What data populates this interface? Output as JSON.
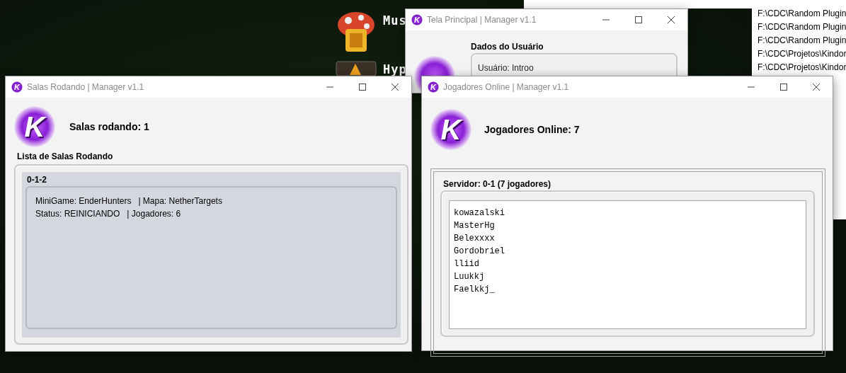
{
  "desktop": {
    "server_list": [
      {
        "name": "Mus",
        "kind": "mushroom"
      },
      {
        "name": "Hyp",
        "kind": "shield"
      }
    ],
    "explorer_paths": [
      "F:\\CDC\\Random Plugin",
      "F:\\CDC\\Random Plugin",
      "F:\\CDC\\Random Plugin",
      "F:\\CDC\\Projetos\\Kindor",
      "F:\\CDC\\Projetos\\Kindor"
    ]
  },
  "windows": [
    {
      "kind": "user",
      "title": "Tela Principal | Manager v1.1",
      "title_icon_text": "K",
      "section_title": "Dados do Usuário",
      "lines": [
        "Usuário: Introo"
      ]
    },
    {
      "kind": "rooms",
      "title": "Salas Rodando | Manager v1.1",
      "title_icon_text": "K",
      "logo_text": "K",
      "heading": "Salas rodando: 1",
      "section_title": "Lista de Salas Rodando",
      "rooms": [
        {
          "id": "0-1-2",
          "lines": [
            "MiniGame: EnderHunters   | Mapa: NetherTargets",
            "Status: REINICIANDO   | Jogadores: 6"
          ]
        }
      ]
    },
    {
      "kind": "players",
      "title": "Jogadores Online | Manager v1.1",
      "title_icon_text": "K",
      "logo_text": "K",
      "heading": "Jogadores Online: 7",
      "section_title": "Servidor: 0-1 (7 jogadores)",
      "players": [
        "kowazalski",
        "MasterHg",
        "Belexxxx",
        "Gordobriel",
        "lliid",
        "Luukkj",
        "Faelkkj_"
      ]
    }
  ]
}
